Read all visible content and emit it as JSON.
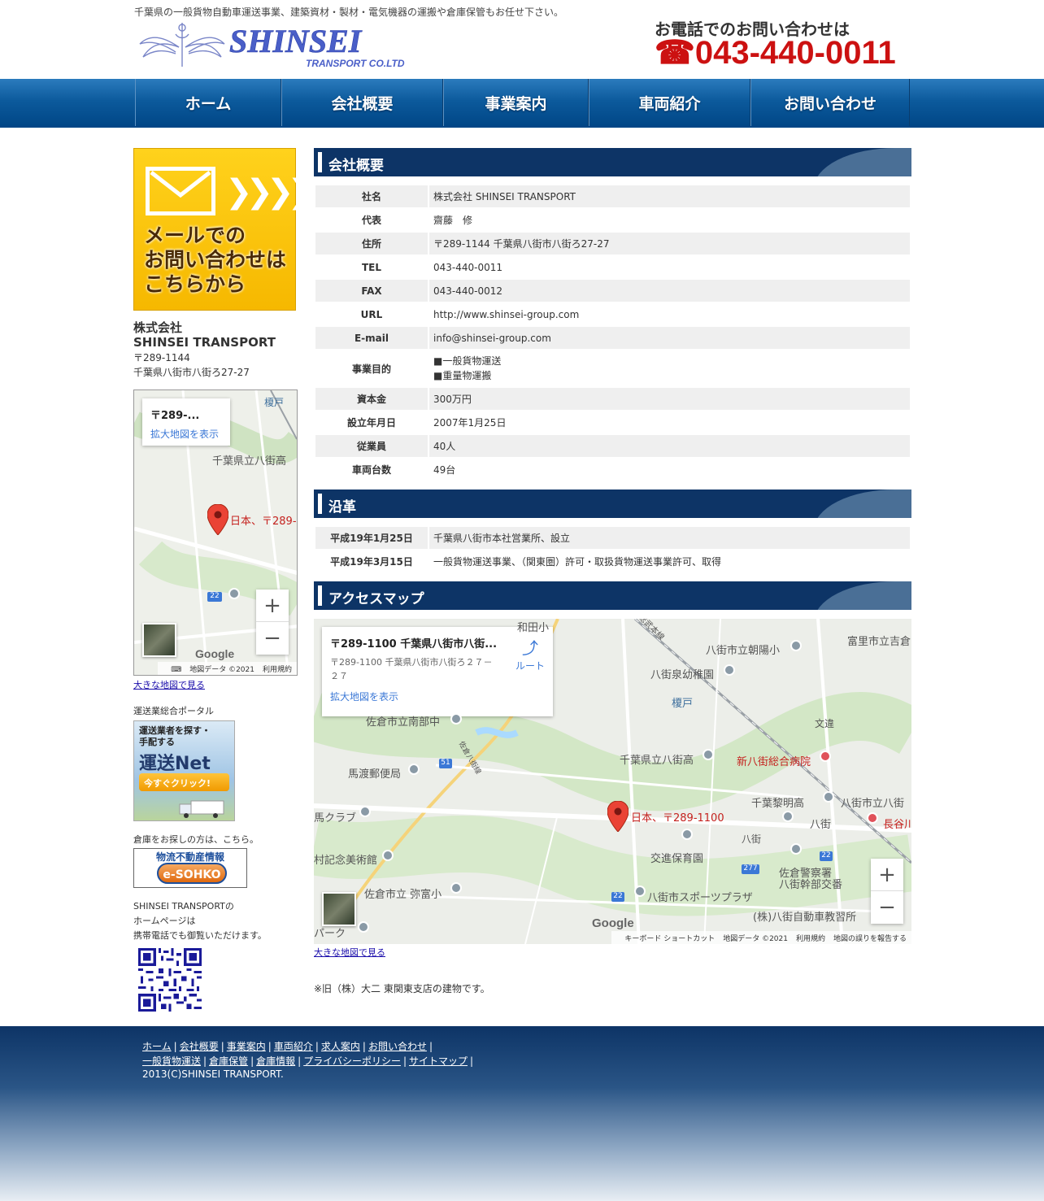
{
  "header": {
    "tagline": "千葉県の一般貨物自動車運送事業、建築資材・製材・電気機器の運搬や倉庫保管もお任せ下さい。",
    "logo_text": "SHINSEI",
    "logo_sub": "TRANSPORT CO.LTD",
    "tel_label": "お電話でのお問い合わせは",
    "tel_number": "043-440-0011"
  },
  "nav": [
    "ホーム",
    "会社概要",
    "事業案内",
    "車両紹介",
    "お問い合わせ"
  ],
  "sidebar": {
    "mail_banner": "メールでの\nお問い合わせは\nこちらから",
    "company_line1": "株式会社",
    "company_line2": "SHINSEI TRANSPORT",
    "postal": "〒289-1144",
    "address": "千葉県八街市八街ろ27-27",
    "map": {
      "card_title": "〒289-...",
      "card_link": "拡大地図を表示",
      "label_school": "千葉県立八街高",
      "label_pin": "日本、〒289-",
      "label_station": "榎戸",
      "road": "22",
      "google": "Google",
      "footer_data": "地図データ ©2021",
      "footer_terms": "利用規約"
    },
    "map_link": "大きな地図で見る",
    "portal_label": "運送業総合ポータル",
    "unso_banner": {
      "line1": "運送業者を探す・",
      "line2": "手配する",
      "title": "運送Net",
      "button": "今すぐクリック!"
    },
    "soko_label": "倉庫をお探しの方は、こちら。",
    "soko_banner": {
      "title": "物流不動産情報",
      "pill": "e-SOHKO"
    },
    "mobile_line1": "SHINSEI TRANSPORTの",
    "mobile_line2": "ホームページは",
    "mobile_line3": "携帯電話でも御覧いただけます。"
  },
  "main": {
    "company_heading": "会社概要",
    "company_rows": [
      {
        "label": "社名",
        "value": "株式会社 SHINSEI TRANSPORT"
      },
      {
        "label": "代表",
        "value": "齋藤　修"
      },
      {
        "label": "住所",
        "value": "〒289-1144 千葉県八街市八街ろ27-27"
      },
      {
        "label": "TEL",
        "value": "043-440-0011"
      },
      {
        "label": "FAX",
        "value": "043-440-0012"
      },
      {
        "label": "URL",
        "value": "http://www.shinsei-group.com"
      },
      {
        "label": "E-mail",
        "value": "info@shinsei-group.com"
      },
      {
        "label": "事業目的",
        "value": "■一般貨物運送",
        "value2": "■重量物運搬"
      },
      {
        "label": "資本金",
        "value": "300万円"
      },
      {
        "label": "設立年月日",
        "value": "2007年1月25日"
      },
      {
        "label": "従業員",
        "value": "40人"
      },
      {
        "label": "車両台数",
        "value": "49台"
      }
    ],
    "history_heading": "沿革",
    "history_rows": [
      {
        "label": "平成19年1月25日",
        "value": "千葉県八街市本社営業所、設立"
      },
      {
        "label": "平成19年3月15日",
        "value": "一般貨物運送事業、（関東圏）許可・取扱貨物運送事業許可、取得"
      }
    ],
    "access_heading": "アクセスマップ",
    "map": {
      "card_title": "〒289-1100 千葉県八街市八街...",
      "card_addr": "〒289-1100 千葉県八街市八街ろ２７－２７",
      "card_route": "ルート",
      "card_link": "拡大地図を表示",
      "labels": {
        "wadata": "和田小",
        "chuo": "総武本線",
        "tomisato": "富里市立吉倉",
        "asahi": "八街市立朝陽小",
        "izumi": "八街泉幼稚園",
        "enokido": "榎戸",
        "minami": "佐倉市立南部中",
        "bunnou": "文違",
        "yachimata_high": "千葉県立八街高",
        "hospital": "新八街総合病院",
        "mawatari": "馬渡郵便局",
        "road51": "51",
        "sakura_road": "佐倉八街線",
        "reimei": "千葉黎明高",
        "yachimata_sch": "八街市立八街",
        "hasegawa": "長谷川",
        "club": "馬クラブ",
        "pin_label": "日本、〒289-1100",
        "yachimata": "八街",
        "yachimata_sta": "八街",
        "museum": "村記念美術館",
        "kotsushin": "交進保育園",
        "police": "佐倉警察署",
        "police2": "八街幹部交番",
        "road277": "277",
        "road22a": "22",
        "mifuku": "佐倉市立 弥富小",
        "road22b": "22",
        "sports": "八街市スポーツプラザ",
        "park": "パーク",
        "driving": "(株)八街自動車教習所"
      },
      "google": "Google",
      "footer_keys": "キーボード ショートカット",
      "footer_data": "地図データ ©2021",
      "footer_terms": "利用規約",
      "footer_report": "地図の誤りを報告する"
    },
    "map_link": "大きな地図で見る",
    "note": "※旧（株）大二 東関東支店の建物です。"
  },
  "footer": {
    "links_row1": [
      "ホーム",
      "会社概要",
      "事業案内",
      "車両紹介",
      "求人案内",
      "お問い合わせ"
    ],
    "links_row2": [
      "一般貨物運送",
      "倉庫保管",
      "倉庫情報",
      "プライバシーポリシー",
      "サイトマップ"
    ],
    "copyright": "2013(C)SHINSEI TRANSPORT."
  },
  "colors": {
    "nav_blue": "#0c5a9c",
    "section_navy": "#0d3466",
    "tel_red": "#cc1111",
    "banner_yellow": "#ffd21c"
  }
}
